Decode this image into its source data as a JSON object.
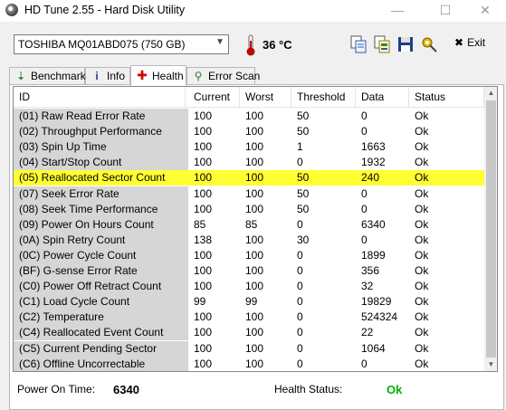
{
  "window": {
    "title": "HD Tune 2.55 - Hard Disk Utility",
    "minimize": "—",
    "maximize": "☐",
    "close": "✕"
  },
  "toolbar": {
    "drive": "TOSHIBA MQ01ABD075 (750 GB)",
    "temperature": "36 °C",
    "exit_label": "Exit",
    "icons": [
      "copy-text-icon",
      "copy-info-icon",
      "save-icon",
      "options-icon"
    ]
  },
  "tabs": [
    {
      "label": "Benchmark",
      "icon": "benchmark-icon"
    },
    {
      "label": "Info",
      "icon": "info-icon"
    },
    {
      "label": "Health",
      "icon": "health-cross-icon"
    },
    {
      "label": "Error Scan",
      "icon": "magnifier-icon"
    }
  ],
  "table": {
    "columns": [
      "ID",
      "Current",
      "Worst",
      "Threshold",
      "Data",
      "Status"
    ],
    "highlighted_row": 4,
    "highlight_color": "#ffff33",
    "rows": [
      [
        "(01) Raw Read Error Rate",
        "100",
        "100",
        "50",
        "0",
        "Ok"
      ],
      [
        "(02) Throughput Performance",
        "100",
        "100",
        "50",
        "0",
        "Ok"
      ],
      [
        "(03) Spin Up Time",
        "100",
        "100",
        "1",
        "1663",
        "Ok"
      ],
      [
        "(04) Start/Stop Count",
        "100",
        "100",
        "0",
        "1932",
        "Ok"
      ],
      [
        "(05) Reallocated Sector Count",
        "100",
        "100",
        "50",
        "240",
        "Ok"
      ],
      [
        "(07) Seek Error Rate",
        "100",
        "100",
        "50",
        "0",
        "Ok"
      ],
      [
        "(08) Seek Time Performance",
        "100",
        "100",
        "50",
        "0",
        "Ok"
      ],
      [
        "(09) Power On Hours Count",
        "85",
        "85",
        "0",
        "6340",
        "Ok"
      ],
      [
        "(0A) Spin Retry Count",
        "138",
        "100",
        "30",
        "0",
        "Ok"
      ],
      [
        "(0C) Power Cycle Count",
        "100",
        "100",
        "0",
        "1899",
        "Ok"
      ],
      [
        "(BF) G-sense Error Rate",
        "100",
        "100",
        "0",
        "356",
        "Ok"
      ],
      [
        "(C0) Power Off Retract Count",
        "100",
        "100",
        "0",
        "32",
        "Ok"
      ],
      [
        "(C1) Load Cycle Count",
        "99",
        "99",
        "0",
        "19829",
        "Ok"
      ],
      [
        "(C2) Temperature",
        "100",
        "100",
        "0",
        "524324",
        "Ok"
      ],
      [
        "(C4) Reallocated Event Count",
        "100",
        "100",
        "0",
        "22",
        "Ok"
      ],
      [
        "(C5) Current Pending Sector",
        "100",
        "100",
        "0",
        "1064",
        "Ok"
      ],
      [
        "(C6) Offline Uncorrectable",
        "100",
        "100",
        "0",
        "0",
        "Ok"
      ]
    ]
  },
  "status": {
    "power_on_label": "Power On Time:",
    "power_on_value": "6340",
    "health_label": "Health Status:",
    "health_value": "Ok",
    "health_color": "#00b000"
  }
}
